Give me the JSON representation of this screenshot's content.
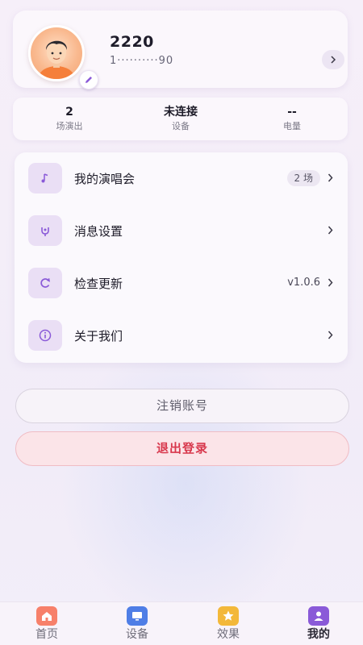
{
  "profile": {
    "name": "2220",
    "id": "1··········90"
  },
  "stats": [
    {
      "value": "2",
      "label": "场演出"
    },
    {
      "value": "未连接",
      "label": "设备"
    },
    {
      "value": "--",
      "label": "电量"
    }
  ],
  "menu": [
    {
      "label": "我的演唱会",
      "badge": "2 场",
      "icon": "music-note-icon"
    },
    {
      "label": "消息设置",
      "icon": "notification-icon"
    },
    {
      "label": "检查更新",
      "value": "v1.0.6",
      "icon": "refresh-icon"
    },
    {
      "label": "关于我们",
      "icon": "info-icon"
    }
  ],
  "buttons": {
    "cancel_account": "注销账号",
    "logout": "退出登录"
  },
  "nav": [
    {
      "label": "首页",
      "icon": "home-icon",
      "color": "#f7806a"
    },
    {
      "label": "设备",
      "icon": "monitor-icon",
      "color": "#4f7ee6"
    },
    {
      "label": "效果",
      "icon": "star-icon",
      "color": "#f3b83a"
    },
    {
      "label": "我的",
      "icon": "user-icon",
      "color": "#8a5ad8",
      "active": true
    }
  ],
  "colors": {
    "accent": "#8a5ad8",
    "danger": "#d8384d",
    "icon_bg": "#eadff5"
  }
}
